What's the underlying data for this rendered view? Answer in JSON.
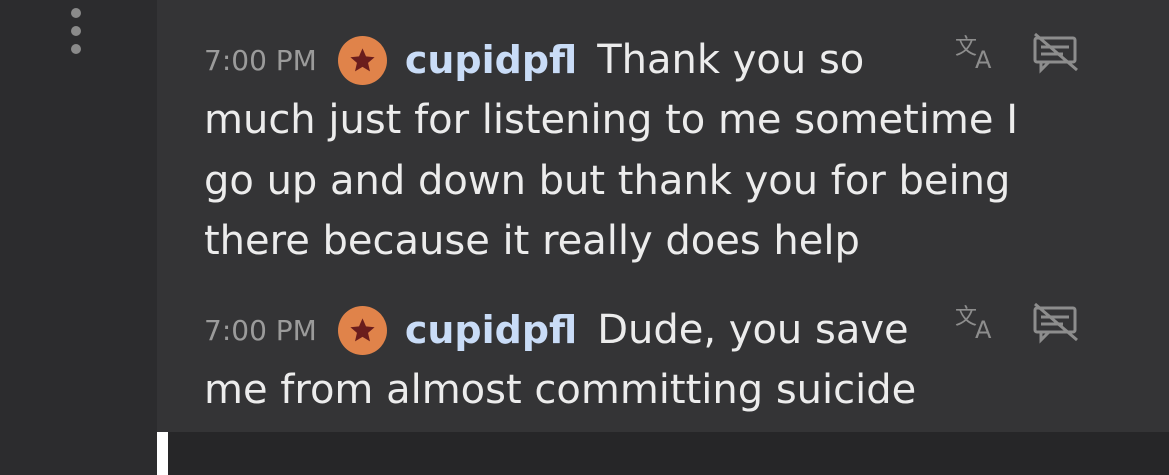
{
  "left_rail": {
    "menu_icon": "vertical-ellipsis-icon"
  },
  "messages": [
    {
      "time": "7:00 PM",
      "username": "cupidpfl",
      "badge_icon": "star-badge-icon",
      "first_line": "Thank you so",
      "lines": [
        "much just for listening to me sometime I",
        "go up and down but thank you for being",
        "there because it really does help"
      ]
    },
    {
      "time": "7:00 PM",
      "username": "cupidpfl",
      "badge_icon": "star-badge-icon",
      "first_line": "Dude, you save",
      "lines": [
        "me from almost committing suicide"
      ]
    }
  ],
  "icons": {
    "translate": "translate-icon",
    "hide": "hide-message-icon"
  },
  "colors": {
    "background": "#343436",
    "sidebar": "#2c2c2e",
    "text": "#ececec",
    "username": "#c9dcf7",
    "timestamp": "#9b9b9b",
    "badge": "#e0834a",
    "star": "#6a1d1d"
  }
}
